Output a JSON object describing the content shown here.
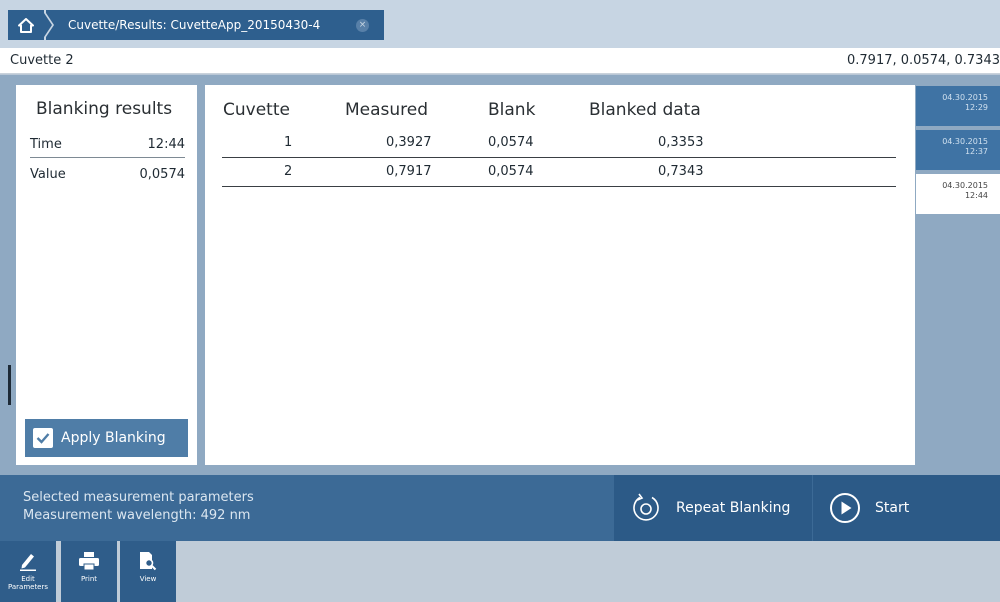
{
  "titlebar": {
    "tab_label": "Cuvette/Results: CuvetteApp_20150430-4",
    "close_glyph": "×"
  },
  "subheader": {
    "cuvette_label": "Cuvette 2",
    "values": "0.7917, 0.0574, 0.7343"
  },
  "blanking": {
    "title": "Blanking results",
    "rows": [
      {
        "key": "Time",
        "value": "12:44"
      },
      {
        "key": "Value",
        "value": "0,0574"
      }
    ],
    "apply_label": "Apply Blanking"
  },
  "table": {
    "headers": [
      "Cuvette",
      "Measured",
      "Blank",
      "Blanked data"
    ],
    "rows": [
      {
        "cuvette": "1",
        "measured": "0,3927",
        "blank": "0,0574",
        "blanked": "0,3353"
      },
      {
        "cuvette": "2",
        "measured": "0,7917",
        "blank": "0,0574",
        "blanked": "0,7343"
      }
    ]
  },
  "history_tabs": [
    {
      "date": "04.30.2015",
      "time": "12:29",
      "active": false
    },
    {
      "date": "04.30.2015",
      "time": "12:37",
      "active": false
    },
    {
      "date": "04.30.2015",
      "time": "12:44",
      "active": true
    }
  ],
  "infobar": {
    "line1": "Selected measurement parameters",
    "line2": "Measurement wavelength: 492 nm",
    "repeat_label": "Repeat Blanking",
    "start_label": "Start"
  },
  "toolbar": {
    "edit_label_1": "Edit",
    "edit_label_2": "Parameters",
    "print_label": "Print",
    "view_label": "View"
  },
  "icons": {
    "home": "home-icon",
    "close": "close-icon",
    "check": "check-icon",
    "repeat": "refresh-icon",
    "start": "play-icon",
    "edit": "pencil-icon",
    "print": "printer-icon",
    "view": "document-search-icon"
  },
  "colors": {
    "accent": "#2e5f8e",
    "panel_bg": "#8fa9c2",
    "info_bar": "#3c6a96"
  }
}
